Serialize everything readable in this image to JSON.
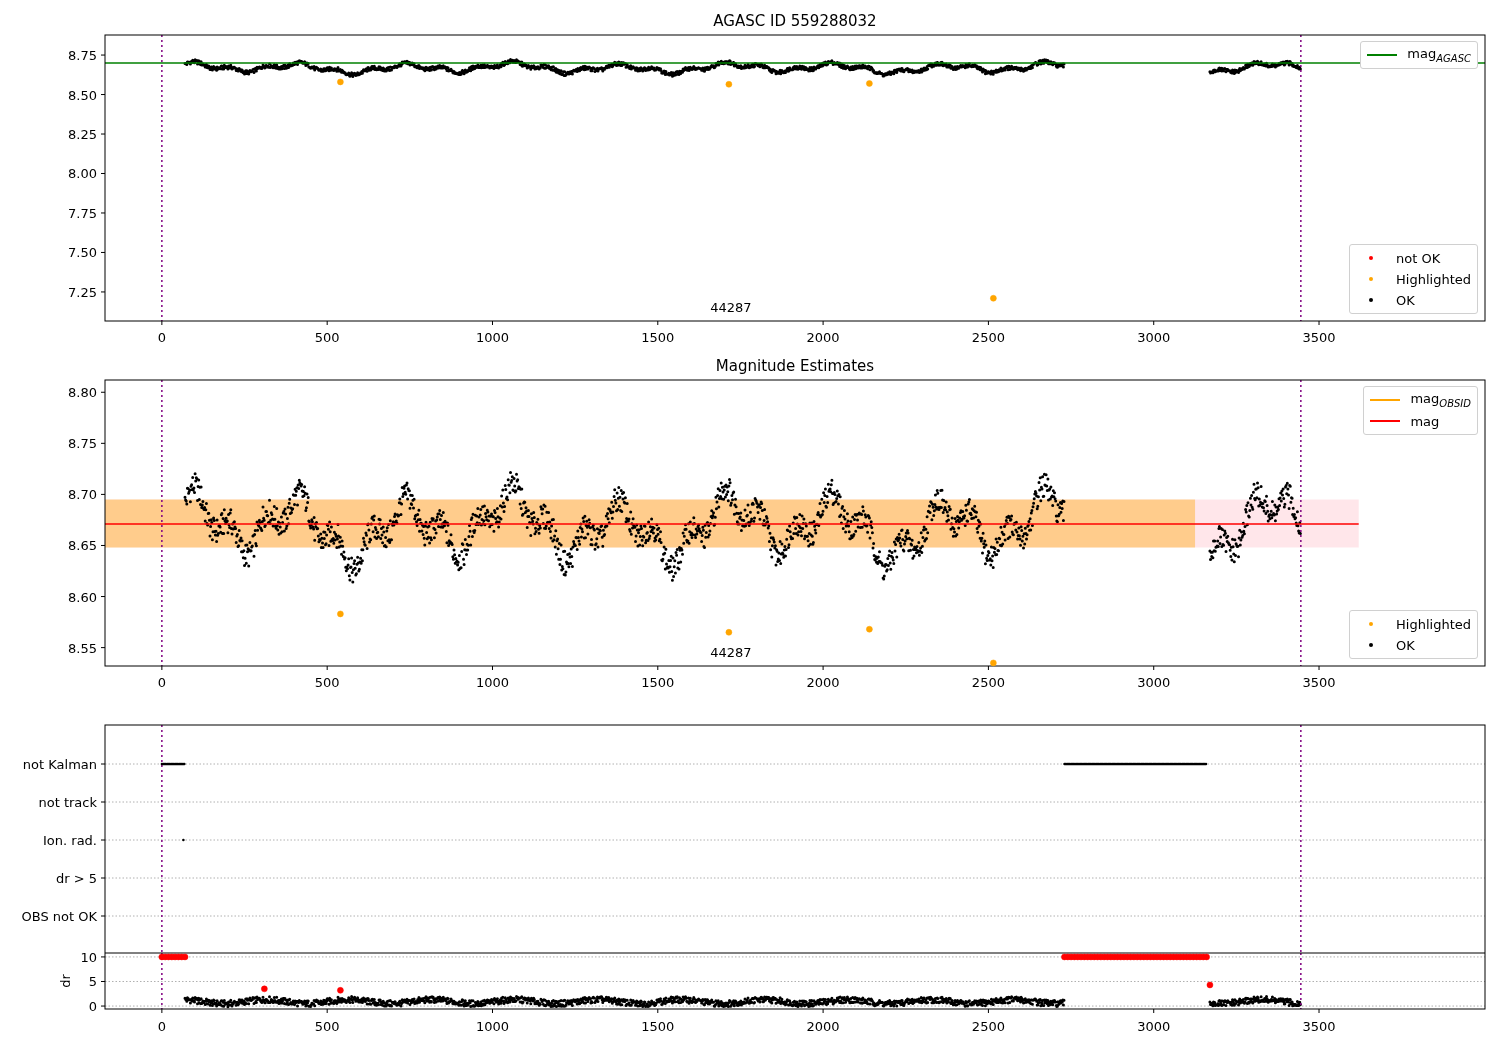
{
  "charts": [
    {
      "kind": "magnitude",
      "chart_data": {
        "type": "scatter",
        "title": "AGASC ID 559288032",
        "xlim": [
          -172,
          4002
        ],
        "ylim": [
          7.066,
          8.877
        ],
        "xticks": [
          {
            "value": 0,
            "label": "0"
          },
          {
            "value": 500,
            "label": "500"
          },
          {
            "value": 1000,
            "label": "1000"
          },
          {
            "value": 1500,
            "label": "1500"
          },
          {
            "value": 2000,
            "label": "2000"
          },
          {
            "value": 2500,
            "label": "2500"
          },
          {
            "value": 3000,
            "label": "3000"
          },
          {
            "value": 3500,
            "label": "3500"
          }
        ],
        "yticks": [
          {
            "value": 7.25,
            "label": "7.25"
          },
          {
            "value": 7.5,
            "label": "7.50"
          },
          {
            "value": 7.75,
            "label": "7.75"
          },
          {
            "value": 8.0,
            "label": "8.00"
          },
          {
            "value": 8.25,
            "label": "8.25"
          },
          {
            "value": 8.5,
            "label": "8.50"
          },
          {
            "value": 8.75,
            "label": "8.75"
          }
        ],
        "series": [
          {
            "color": "#ffa500",
            "x": [
              540,
              1715,
              2140,
              2515
            ],
            "values": [
              8.58,
              8.565,
              8.57,
              7.21
            ]
          }
        ],
        "ref_lines": [
          {
            "axis": "y",
            "value": 8.7,
            "color": "#008000"
          },
          {
            "axis": "x",
            "value": 0,
            "color": "#800080"
          },
          {
            "axis": "x",
            "value": 3445,
            "color": "#800080"
          }
        ],
        "annotations": [
          "44287"
        ]
      },
      "legends": [
        {
          "entries": [
            {
              "label": "mag$_{AGASC}$",
              "kind": "line",
              "color": "#008000"
            }
          ]
        },
        {
          "entries": [
            {
              "label": "not OK",
              "kind": "dot",
              "color": "#ff0000"
            },
            {
              "label": "Highlighted",
              "kind": "dot",
              "color": "#ffa500"
            },
            {
              "label": "OK",
              "kind": "dot",
              "color": "#000000"
            }
          ]
        }
      ]
    },
    {
      "kind": "magnitude",
      "chart_data": {
        "type": "scatter",
        "title": "Magnitude Estimates",
        "xlim": [
          -172,
          4002
        ],
        "ylim": [
          8.532,
          8.812
        ],
        "xticks": [
          {
            "value": 0,
            "label": "0"
          },
          {
            "value": 500,
            "label": "500"
          },
          {
            "value": 1000,
            "label": "1000"
          },
          {
            "value": 1500,
            "label": "1500"
          },
          {
            "value": 2000,
            "label": "2000"
          },
          {
            "value": 2500,
            "label": "2500"
          },
          {
            "value": 3000,
            "label": "3000"
          },
          {
            "value": 3500,
            "label": "3500"
          }
        ],
        "yticks": [
          {
            "value": 8.55,
            "label": "8.55"
          },
          {
            "value": 8.6,
            "label": "8.60"
          },
          {
            "value": 8.65,
            "label": "8.65"
          },
          {
            "value": 8.7,
            "label": "8.70"
          },
          {
            "value": 8.75,
            "label": "8.75"
          },
          {
            "value": 8.8,
            "label": "8.80"
          }
        ],
        "series": [
          {
            "color": "#ffa500",
            "x": [
              540,
              1715,
              2140,
              2515
            ],
            "values": [
              8.583,
              8.565,
              8.568,
              8.535
            ]
          }
        ],
        "bands": [
          {
            "axis": "y",
            "from": 8.648,
            "to": 8.695,
            "color": "#ffc0cb"
          },
          {
            "axis": "y",
            "from": 8.648,
            "to": 8.695,
            "color": "#ffa500"
          }
        ],
        "ref_lines": [
          {
            "axis": "y",
            "value": 8.671,
            "color": "#ff0000"
          },
          {
            "axis": "x",
            "value": 0,
            "color": "#800080"
          },
          {
            "axis": "x",
            "value": 3445,
            "color": "#800080"
          }
        ],
        "annotations": [
          "44287"
        ]
      },
      "legends": [
        {
          "entries": [
            {
              "label": "mag$_{OBSID}$",
              "kind": "line",
              "color": "#ffa500"
            },
            {
              "label": "mag",
              "kind": "line",
              "color": "#ff0000"
            }
          ]
        },
        {
          "entries": [
            {
              "label": "Highlighted",
              "kind": "dot",
              "color": "#ffa500"
            },
            {
              "label": "OK",
              "kind": "dot",
              "color": "#000000"
            }
          ]
        }
      ]
    },
    {
      "kind": "flags",
      "rows": [
        "not Kalman",
        "not track",
        "Ion. rad.",
        "dr > 5",
        "OBS not OK"
      ]
    },
    {
      "kind": "dr",
      "chart_data": {
        "type": "scatter",
        "grid": true,
        "ylabel": "dr",
        "xlim": [
          -172,
          4002
        ],
        "ylim": [
          -0.6,
          10.8
        ],
        "xticks": [
          {
            "value": 0,
            "label": "0"
          },
          {
            "value": 500,
            "label": "500"
          },
          {
            "value": 1000,
            "label": "1000"
          },
          {
            "value": 1500,
            "label": "1500"
          },
          {
            "value": 2000,
            "label": "2000"
          },
          {
            "value": 2500,
            "label": "2500"
          },
          {
            "value": 3000,
            "label": "3000"
          },
          {
            "value": 3500,
            "label": "3500"
          }
        ],
        "yticks": [
          {
            "value": 0,
            "label": "0"
          },
          {
            "value": 5,
            "label": "5"
          },
          {
            "value": 10,
            "label": "10"
          }
        ],
        "series": [
          {
            "color": "#ff0000",
            "x": [
              0,
              10,
              20,
              30,
              40,
              50,
              60,
              70,
              310,
              540,
              2730,
              2740,
              2750,
              2760,
              2770,
              2780,
              2790,
              2800,
              2810,
              2820,
              2830,
              2840,
              2850,
              2860,
              2870,
              2880,
              2890,
              2900,
              2910,
              2920,
              2930,
              2940,
              2950,
              2960,
              2970,
              2980,
              2990,
              3000,
              3010,
              3020,
              3030,
              3040,
              3050,
              3060,
              3070,
              3080,
              3090,
              3100,
              3110,
              3120,
              3130,
              3140,
              3150,
              3160,
              3170
            ],
            "values": [
              10,
              10,
              10,
              10,
              10,
              10,
              10,
              10,
              3.5,
              3.2,
              10,
              10,
              10,
              10,
              10,
              10,
              10,
              10,
              10,
              10,
              10,
              10,
              10,
              10,
              10,
              10,
              10,
              10,
              10,
              10,
              10,
              10,
              10,
              10,
              10,
              10,
              10,
              10,
              10,
              10,
              10,
              10,
              10,
              10,
              10,
              10,
              10,
              10,
              10,
              10,
              10,
              10,
              10,
              10,
              4.3
            ]
          }
        ],
        "ref_lines": [
          {
            "axis": "x",
            "value": 0,
            "color": "#800080"
          },
          {
            "axis": "x",
            "value": 3445,
            "color": "#800080"
          }
        ]
      }
    }
  ]
}
